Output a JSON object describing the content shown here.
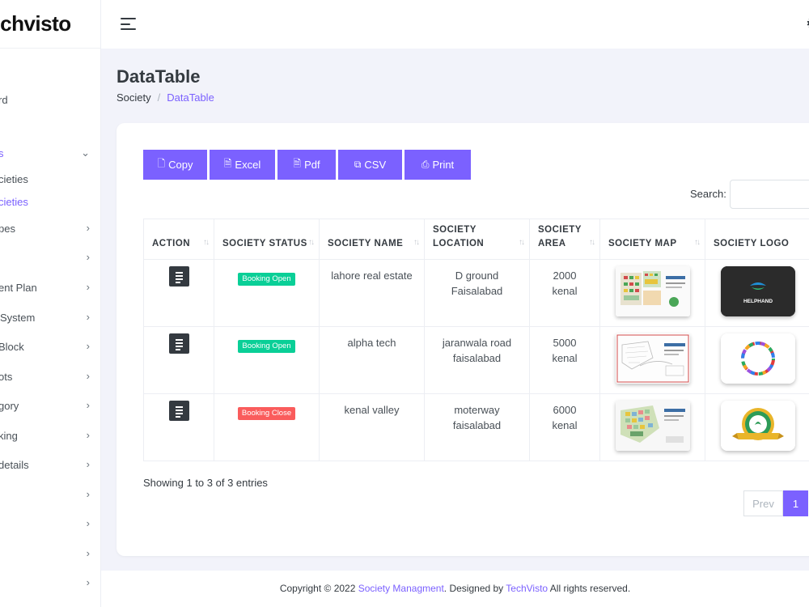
{
  "brand": {
    "name": "techvisto"
  },
  "sidebar": {
    "items": [
      {
        "label": "rd",
        "chevron": ""
      },
      {
        "label": "s",
        "chevron": "⌄"
      },
      {
        "label": "cieties",
        "chevron": ""
      },
      {
        "label": "cieties",
        "chevron": ""
      },
      {
        "label": "pes",
        "chevron": "›"
      },
      {
        "label": "",
        "chevron": "›"
      },
      {
        "label": "ent Plan",
        "chevron": "›"
      },
      {
        "label": "System",
        "chevron": "›"
      },
      {
        "label": "Block",
        "chevron": "›"
      },
      {
        "label": "ots",
        "chevron": "›"
      },
      {
        "label": "gory",
        "chevron": "›"
      },
      {
        "label": "king",
        "chevron": "›"
      },
      {
        "label": "details",
        "chevron": "›"
      },
      {
        "label": "",
        "chevron": "›"
      },
      {
        "label": "",
        "chevron": "›"
      },
      {
        "label": "",
        "chevron": "›"
      },
      {
        "label": "",
        "chevron": "›"
      }
    ]
  },
  "header": {
    "title": "DataTable",
    "breadcrumb": {
      "parent": "Society",
      "separator": "/",
      "current": "DataTable"
    }
  },
  "toolbar": {
    "buttons": [
      {
        "icon": "file-copy-icon",
        "label": "Copy"
      },
      {
        "icon": "file-excel-icon",
        "label": "Excel"
      },
      {
        "icon": "file-pdf-icon",
        "label": "Pdf"
      },
      {
        "icon": "csv-icon",
        "label": "CSV"
      },
      {
        "icon": "printer-icon",
        "label": "Print"
      }
    ],
    "search_label": "Search:",
    "search_placeholder": ""
  },
  "table": {
    "columns": [
      "ACTION",
      "SOCIETY STATUS",
      "SOCIETY NAME",
      "SOCIETY LOCATION",
      "SOCIETY AREA",
      "SOCIETY MAP",
      "SOCIETY LOGO"
    ],
    "rows": [
      {
        "status": "Booking Open",
        "status_color": "#0acf97",
        "name": "lahore real estate",
        "location": "D ground Faisalabad",
        "area": "2000 kenal",
        "logo_text": "HELPHAND"
      },
      {
        "status": "Booking Open",
        "status_color": "#0acf97",
        "name": "alpha tech",
        "location": "jaranwala road faisalabad",
        "area": "5000 kenal",
        "logo_text": ""
      },
      {
        "status": "Booking Close",
        "status_color": "#fa5c5c",
        "name": "kenal valley",
        "location": "moterway faisalabad",
        "area": "6000 kenal",
        "logo_text": ""
      }
    ]
  },
  "info": "Showing 1 to 3 of 3 entries",
  "pagination": {
    "prev": "Prev",
    "current": "1"
  },
  "footer": {
    "prefix": "Copyright © 2022 ",
    "link1": "Society Managment",
    "middle": ". Designed by ",
    "link2": "TechVisto",
    "suffix": " All rights reserved."
  },
  "colors": {
    "accent": "#7b61ff",
    "open": "#0acf97",
    "close": "#fa5c5c",
    "dark_button": "#343a40"
  }
}
